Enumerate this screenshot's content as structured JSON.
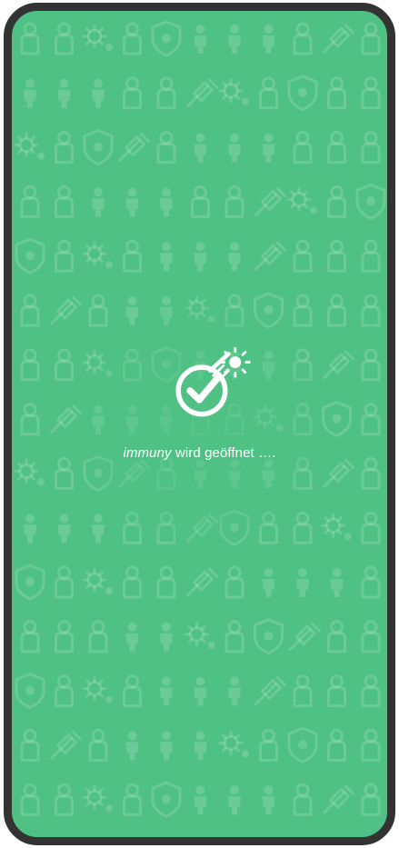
{
  "screen": {
    "background_color": "#4fc184",
    "frame_color": "#333333",
    "pattern_icons": [
      "person-icon",
      "syringe-icon",
      "virus-icon",
      "shield-virus-icon"
    ]
  },
  "splash": {
    "app_name": "immuny",
    "status_text": " wird geöffnet ….",
    "logo_icon": "checkmark-syringe-icon"
  }
}
